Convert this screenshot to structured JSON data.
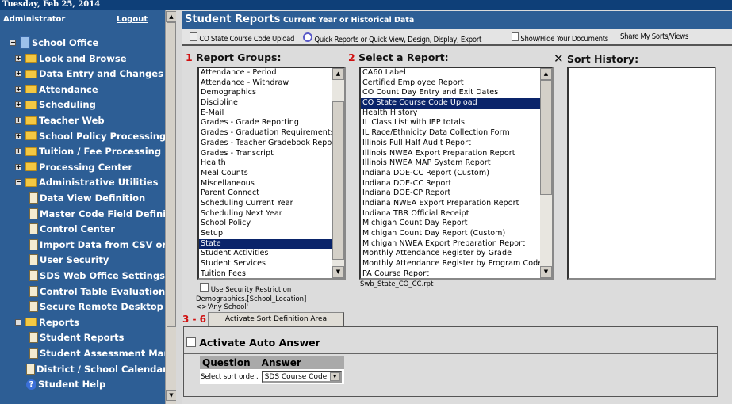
{
  "date": "Tuesday, Feb 25, 2014",
  "sidebar": {
    "user": "Administrator",
    "logout": "Logout",
    "root": "School Office",
    "folders": [
      "Look and Browse",
      "Data Entry and Changes",
      "Attendance",
      "Scheduling",
      "Teacher Web",
      "School Policy Processing",
      "Tuition / Fee Processing",
      "Processing Center"
    ],
    "admin_folder": "Administrative Utilities",
    "admin_items": [
      "Data View Definition",
      "Master Code Field Definition",
      "Control Center",
      "Import Data from CSV or TXT",
      "User Security",
      "SDS Web Office Settings",
      "Control Table Evaluation",
      "Secure Remote Desktop Con"
    ],
    "reports_folder": "Reports",
    "report_items": [
      "Student Reports",
      "Student Assessment Manag"
    ],
    "calendar": "District / School Calendar",
    "help": "Student Help"
  },
  "header": {
    "title": "Student Reports",
    "subtitle": "Current Year or Historical Data"
  },
  "toolbar": {
    "upload": "CO State Course Code Upload",
    "quick": "Quick Reports or Quick View, Design, Display, Export",
    "docs": "Show/Hide Your Documents",
    "share": "Share My Sorts/Views"
  },
  "groups": {
    "num": "1",
    "label": "Report Groups:",
    "selected": "State",
    "items": [
      "Attendance - Period",
      "Attendance - Withdraw",
      "Demographics",
      "Discipline",
      "E-Mail",
      "Grades - Grade Reporting",
      "Grades - Graduation Requirements",
      "Grades - Teacher Gradebook Report",
      "Grades - Transcript",
      "Health",
      "Meal Counts",
      "Miscellaneous",
      "Parent Connect",
      "Scheduling Current Year",
      "Scheduling Next Year",
      "School Policy",
      "Setup",
      "State",
      "Student Activities",
      "Student Services",
      "Tuition Fees"
    ]
  },
  "reports": {
    "num": "2",
    "label": "Select a Report:",
    "selected": "CO State Course Code Upload",
    "file": "Swb_State_CO_CC.rpt",
    "items": [
      "CA60 Label",
      "Certified Employee Report",
      "CO Count Day Entry and Exit Dates",
      "CO State Course Code Upload",
      "Health History",
      "IL Class List with IEP totals",
      "IL Race/Ethnicity Data Collection Form",
      "Illinois Full Half Audit Report",
      "Illinois NWEA Export Preparation Report",
      "Illinois NWEA MAP System Report",
      "Indiana DOE-CC Report (Custom)",
      "Indiana DOE-CC Report",
      "Indiana DOE-CP Report",
      "Indiana NWEA Export Preparation Report",
      "Indiana TBR Official Receipt",
      "Michigan Count Day Report",
      "Michigan Count Day Report (Custom)",
      "Michigan NWEA Export Preparation Report",
      "Monthly Attendance Register by Grade",
      "Monthly Attendance Register by Program Code",
      "PA Course Report"
    ]
  },
  "history": {
    "label": "Sort History:"
  },
  "security": {
    "label": "Use Security Restriction",
    "condition": "Demographics.[School_Location]<>'Any School'"
  },
  "sortdef": {
    "num": "3 - 6",
    "button": "Activate Sort Definition Area"
  },
  "auto": {
    "label": "Activate Auto Answer",
    "col_q": "Question",
    "col_a": "Answer",
    "question": "Select sort order.",
    "answer": "SDS Course Code"
  }
}
